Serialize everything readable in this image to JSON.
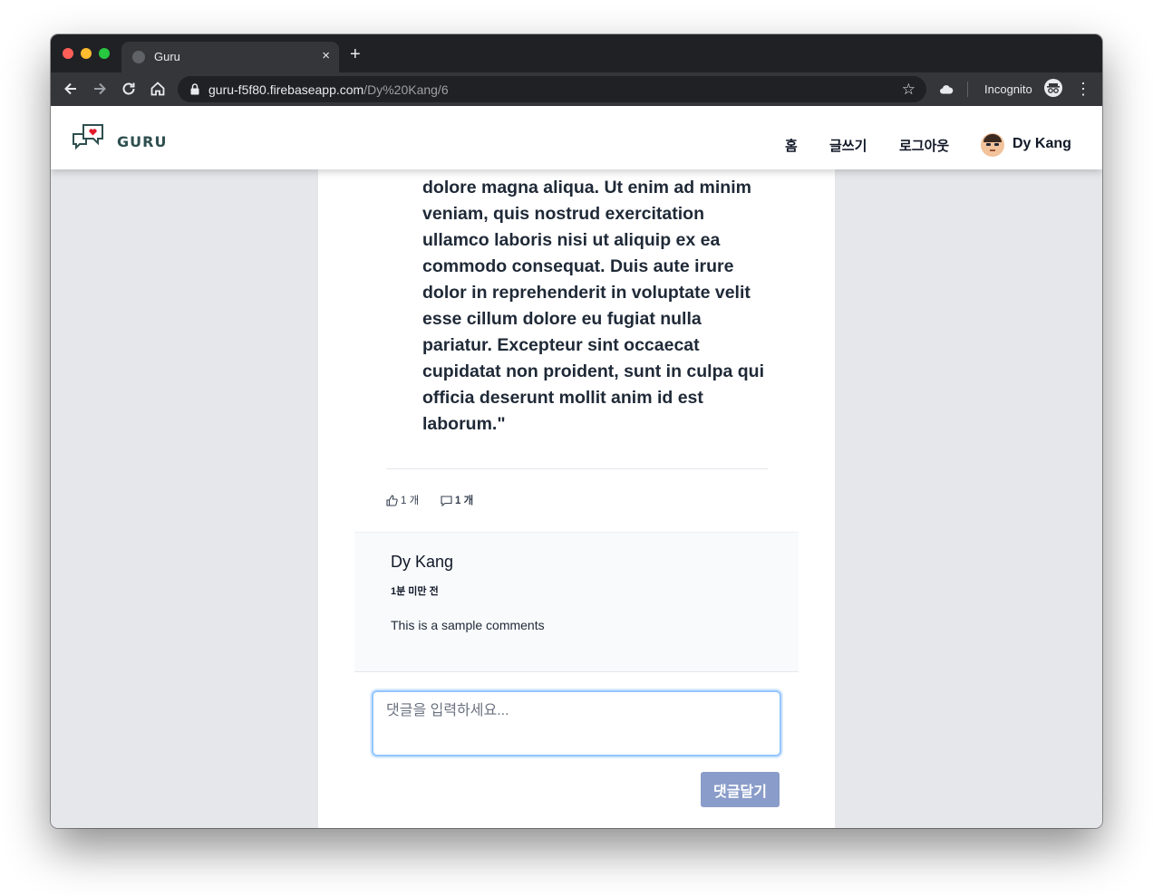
{
  "browser": {
    "tab_title": "Guru",
    "tab_close": "×",
    "new_tab": "+",
    "url_host": "guru-f5f80.firebaseapp.com",
    "url_path": "/Dy%20Kang/6",
    "incognito_label": "Incognito"
  },
  "header": {
    "logo_text": "GURU",
    "nav": [
      "홈",
      "글쓰기",
      "로그아웃"
    ],
    "user_name": "Dy Kang"
  },
  "post": {
    "body": "dolore magna aliqua. Ut enim ad minim veniam, quis nostrud exercitation ullamco laboris nisi ut aliquip ex ea commodo consequat. Duis aute irure dolor in reprehenderit in voluptate velit esse cillum dolore eu fugiat nulla pariatur. Excepteur sint occaecat cupidatat non proident, sunt in culpa qui officia deserunt mollit anim id est laborum.\"",
    "likes_label": "1 개",
    "comments_label": "1 개"
  },
  "comment": {
    "author": "Dy Kang",
    "time": "1분 미만 전",
    "text": "This is a sample comments"
  },
  "comment_form": {
    "placeholder": "댓글을 입력하세요...",
    "submit_label": "댓글달기"
  }
}
